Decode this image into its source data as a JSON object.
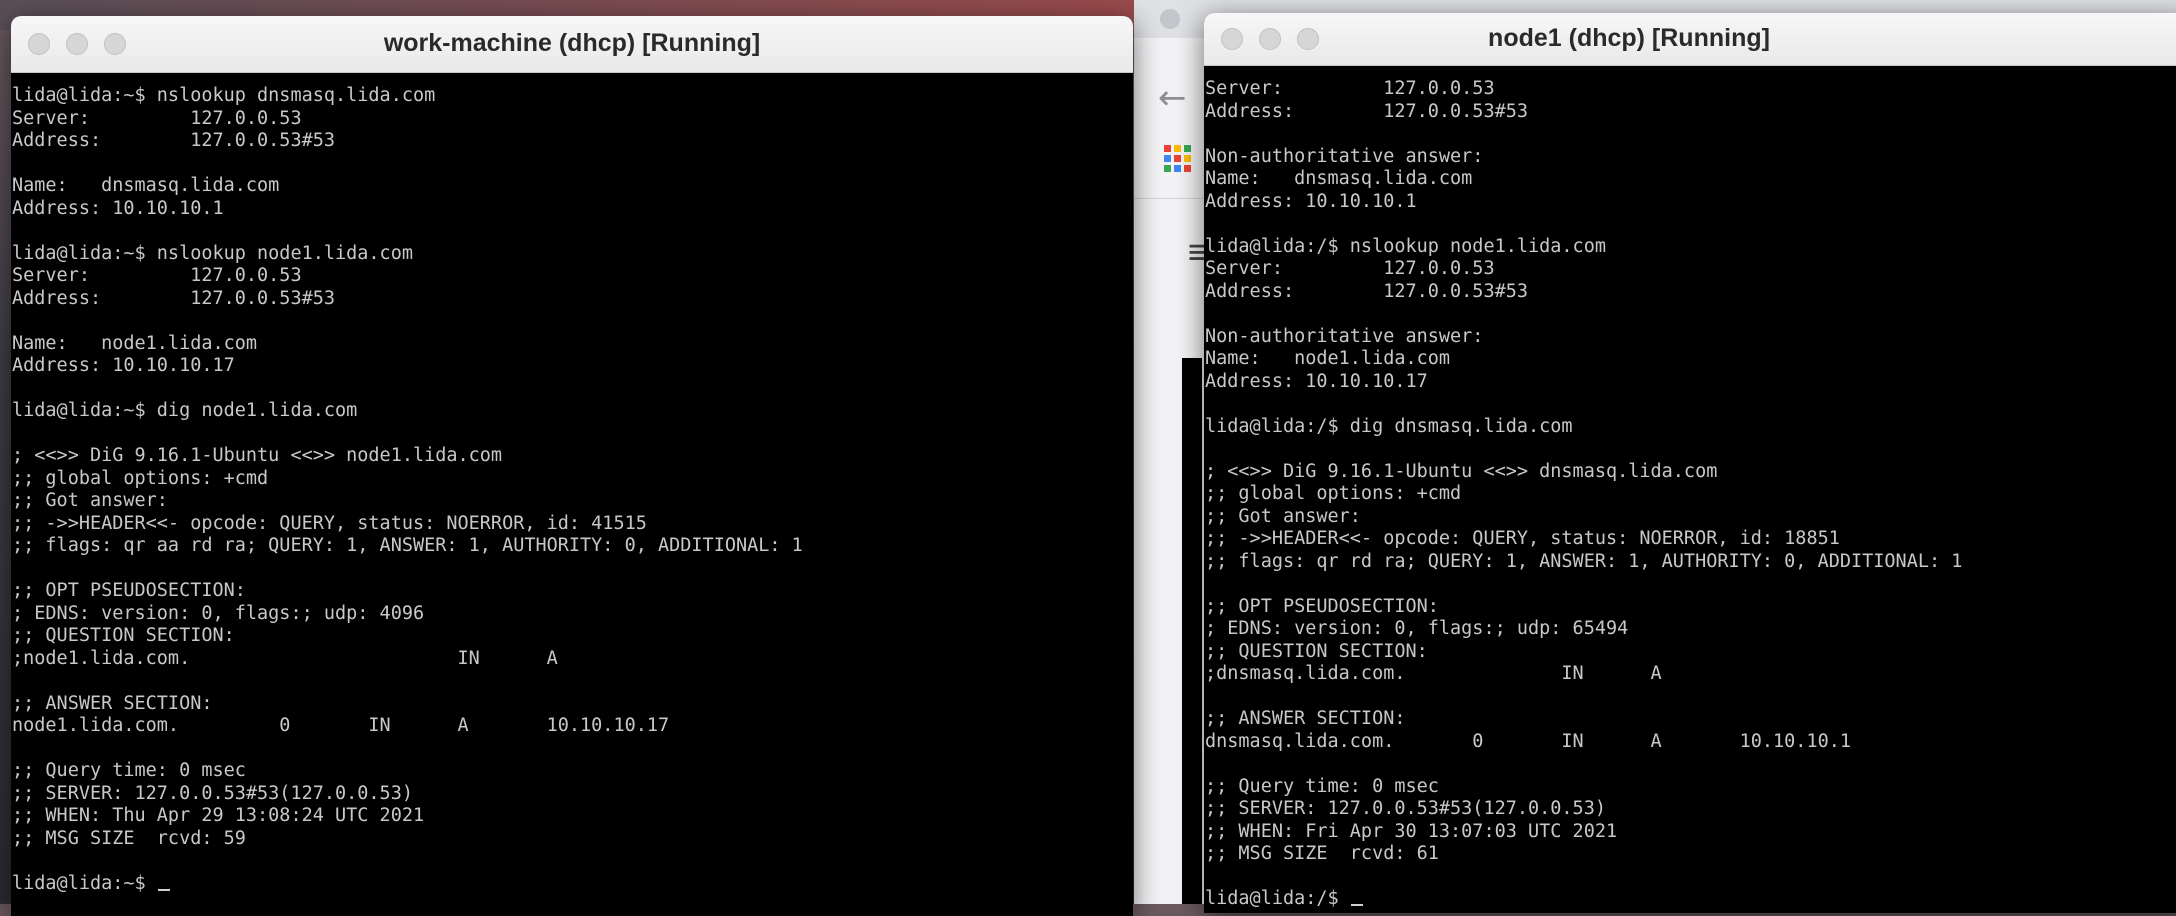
{
  "vm1": {
    "title": "work-machine (dhcp) [Running]",
    "terminal_lines": [
      "lida@lida:~$ nslookup dnsmasq.lida.com",
      "Server:         127.0.0.53",
      "Address:        127.0.0.53#53",
      "",
      "Name:   dnsmasq.lida.com",
      "Address: 10.10.10.1",
      "",
      "lida@lida:~$ nslookup node1.lida.com",
      "Server:         127.0.0.53",
      "Address:        127.0.0.53#53",
      "",
      "Name:   node1.lida.com",
      "Address: 10.10.10.17",
      "",
      "lida@lida:~$ dig node1.lida.com",
      "",
      "; <<>> DiG 9.16.1-Ubuntu <<>> node1.lida.com",
      ";; global options: +cmd",
      ";; Got answer:",
      ";; ->>HEADER<<- opcode: QUERY, status: NOERROR, id: 41515",
      ";; flags: qr aa rd ra; QUERY: 1, ANSWER: 1, AUTHORITY: 0, ADDITIONAL: 1",
      "",
      ";; OPT PSEUDOSECTION:",
      "; EDNS: version: 0, flags:; udp: 4096",
      ";; QUESTION SECTION:",
      ";node1.lida.com.                        IN      A",
      "",
      ";; ANSWER SECTION:",
      "node1.lida.com.         0       IN      A       10.10.10.17",
      "",
      ";; Query time: 0 msec",
      ";; SERVER: 127.0.0.53#53(127.0.0.53)",
      ";; WHEN: Thu Apr 29 13:08:24 UTC 2021",
      ";; MSG SIZE  rcvd: 59",
      ""
    ],
    "prompt": "lida@lida:~$ "
  },
  "vm2": {
    "title": "node1 (dhcp) [Running]",
    "terminal_lines": [
      "Server:         127.0.0.53",
      "Address:        127.0.0.53#53",
      "",
      "Non-authoritative answer:",
      "Name:   dnsmasq.lida.com",
      "Address: 10.10.10.1",
      "",
      "lida@lida:/$ nslookup node1.lida.com",
      "Server:         127.0.0.53",
      "Address:        127.0.0.53#53",
      "",
      "Non-authoritative answer:",
      "Name:   node1.lida.com",
      "Address: 10.10.10.17",
      "",
      "lida@lida:/$ dig dnsmasq.lida.com",
      "",
      "; <<>> DiG 9.16.1-Ubuntu <<>> dnsmasq.lida.com",
      ";; global options: +cmd",
      ";; Got answer:",
      ";; ->>HEADER<<- opcode: QUERY, status: NOERROR, id: 18851",
      ";; flags: qr rd ra; QUERY: 1, ANSWER: 1, AUTHORITY: 0, ADDITIONAL: 1",
      "",
      ";; OPT PSEUDOSECTION:",
      "; EDNS: version: 0, flags:; udp: 65494",
      ";; QUESTION SECTION:",
      ";dnsmasq.lida.com.              IN      A",
      "",
      ";; ANSWER SECTION:",
      "dnsmasq.lida.com.       0       IN      A       10.10.10.1",
      "",
      ";; Query time: 0 msec",
      ";; SERVER: 127.0.0.53#53(127.0.0.53)",
      ";; WHEN: Fri Apr 30 13:07:03 UTC 2021",
      ";; MSG SIZE  rcvd: 61",
      ""
    ],
    "prompt": "lida@lida:/$ "
  },
  "background_browser": {
    "back_icon": "arrow-left-icon",
    "apps_icon": "apps-grid-icon",
    "menu_icon": "hamburger-menu-icon",
    "apps_colors": [
      "#ea4335",
      "#fbbc05",
      "#34a853",
      "#4285f4",
      "#ea4335",
      "#fbbc05",
      "#34a853",
      "#4285f4",
      "#ea4335"
    ]
  }
}
